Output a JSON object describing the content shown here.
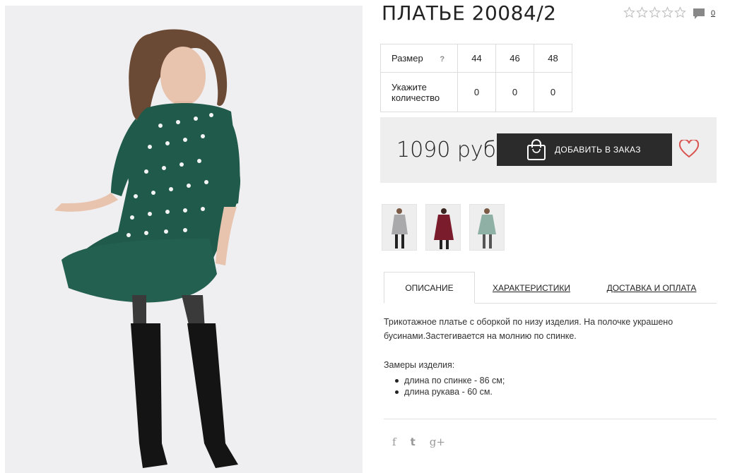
{
  "product": {
    "title": "ПЛАТЬЕ 20084/2",
    "rating_stars": 5,
    "rating_filled": 0,
    "comment_count": "0",
    "price": "1090 руб",
    "add_to_order_label": "ДОБАВИТЬ В ЗАКАЗ"
  },
  "size_table": {
    "size_label": "Размер",
    "help_label": "?",
    "quantity_label_line1": "Укажите",
    "quantity_label_line2": "количество",
    "sizes": [
      "44",
      "46",
      "48"
    ],
    "quantities": [
      "0",
      "0",
      "0"
    ]
  },
  "thumbnails": [
    {
      "color": "gray"
    },
    {
      "color": "burgundy"
    },
    {
      "color": "mint"
    }
  ],
  "tabs": [
    {
      "label": "ОПИСАНИЕ"
    },
    {
      "label": "ХАРАКТЕРИСТИКИ"
    },
    {
      "label": "ДОСТАВКА И ОПЛАТА"
    }
  ],
  "description": {
    "text": "Трикотажное платье с оборкой по низу изделия. На полочке украшено бусинами.Застегивается на молнию по спинке.",
    "measures_title": "Замеры изделия:",
    "measures": [
      "длина по спинке - 86 см;",
      "длина рукава - 60 см."
    ]
  },
  "social": [
    {
      "icon": "facebook-icon",
      "glyph": "f"
    },
    {
      "icon": "twitter-icon",
      "glyph": "t"
    },
    {
      "icon": "googleplus-icon",
      "glyph": "g+"
    }
  ],
  "colors": {
    "button_bg": "#2b2b2b",
    "price_block_bg": "#eeeeee",
    "heart": "#d9534f",
    "dress_green": "#1f5a4a"
  }
}
